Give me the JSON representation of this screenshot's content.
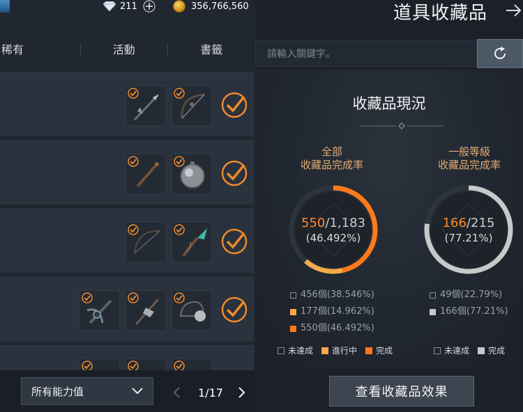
{
  "header": {
    "diamonds": "211",
    "gold": "356,766,560"
  },
  "tabs": [
    "稀有",
    "活動",
    "書籤"
  ],
  "rows": [
    {
      "items": [
        "spear-icon",
        "bow-icon"
      ]
    },
    {
      "items": [
        "staff-icon",
        "orb-icon"
      ]
    },
    {
      "items": [
        "longbow-icon",
        "wand-icon"
      ]
    },
    {
      "items": [
        "crossbow-icon",
        "halberd-icon",
        "helm-icon"
      ]
    }
  ],
  "filter": {
    "selected": "所有能力值"
  },
  "pagination": {
    "label": "1/17",
    "current": 1,
    "total": 17
  },
  "panel": {
    "title": "道具收藏品",
    "search_placeholder": "請輸入關鍵字。",
    "status_title": "收藏品現況",
    "effect_button": "查看收藏品效果"
  },
  "overall": {
    "label_line1": "全部",
    "label_line2": "收藏品完成率",
    "done": "550",
    "total": "/1,183",
    "percent": "(46.492%)",
    "fraction_complete": 0.46492,
    "fraction_in_progress": 0.14962,
    "stats": [
      "456個(38.546%)",
      "177個(14.962%)",
      "550個(46.492%)"
    ],
    "legend": [
      "未達成",
      "進行中",
      "完成"
    ]
  },
  "general": {
    "label_line1": "一般等級",
    "label_line2": "收藏品完成率",
    "done": "166",
    "total": "/215",
    "percent": "(77.21%)",
    "fraction_complete": 0.7721,
    "stats": [
      "49個(22.79%)",
      "166個(77.21%)"
    ],
    "legend": [
      "未達成",
      "完成"
    ]
  },
  "colors": {
    "accent": "#ff7a1a",
    "in_progress": "#f5a94a",
    "complete_gray": "#c8c8c8",
    "check": "#f08a2c"
  }
}
